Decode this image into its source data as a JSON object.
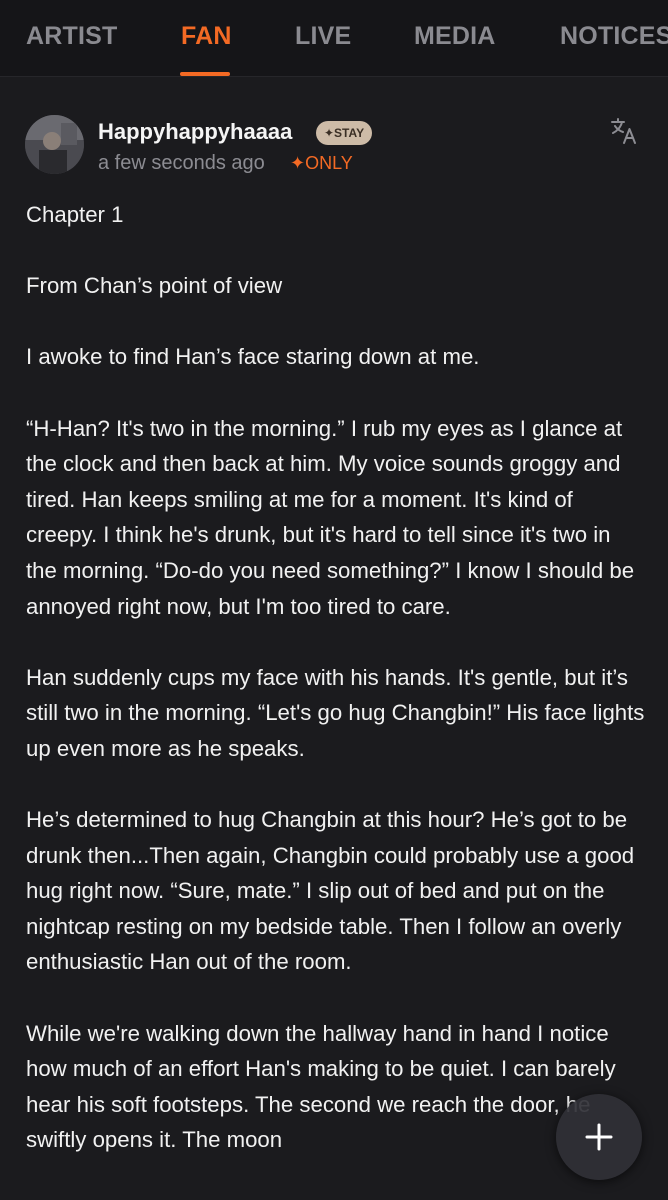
{
  "tabs": [
    {
      "label": "ARTIST",
      "active": false
    },
    {
      "label": "FAN",
      "active": true
    },
    {
      "label": "LIVE",
      "active": false
    },
    {
      "label": "MEDIA",
      "active": false
    },
    {
      "label": "NOTICES",
      "active": false
    }
  ],
  "post": {
    "username": "Happyhappyhaaaa",
    "badge": "✦STAY",
    "timestamp": "a few seconds ago",
    "only_label": "✦ONLY",
    "translate_icon": "translate-icon",
    "paragraphs": [
      "Chapter 1",
      "From Chan’s point of view",
      "I awoke to find Han’s face staring down at me.",
      "“H-Han? It's two in the morning.” I rub my eyes as I glance at the clock and then back at him. My voice sounds groggy and tired. Han keeps smiling at me for a moment. It's kind of creepy. I think he's drunk, but it's hard to tell since it's two in the morning. “Do-do you need something?” I know I should be annoyed right now, but I'm too tired to care.",
      "Han suddenly cups my face with his hands. It's gentle, but it’s still two in the morning. “Let's go hug Changbin!” His face lights up even more as he speaks.",
      "He’s determined to hug Changbin at this hour? He’s got to be drunk then...Then again, Changbin could probably use a good hug right now. “Sure, mate.” I slip out of bed and put on the nightcap resting on my bedside table. Then I follow an overly enthusiastic Han out of the room.",
      "While we're walking down the hallway hand in hand I notice how much of an effort Han's making to be quiet. I can barely hear his soft footsteps.  The second we reach the door, he swiftly opens it. The moon"
    ]
  },
  "fab": {
    "icon": "plus-icon"
  },
  "colors": {
    "accent": "#f46a24",
    "background": "#1b1b1e",
    "header": "#151518"
  }
}
